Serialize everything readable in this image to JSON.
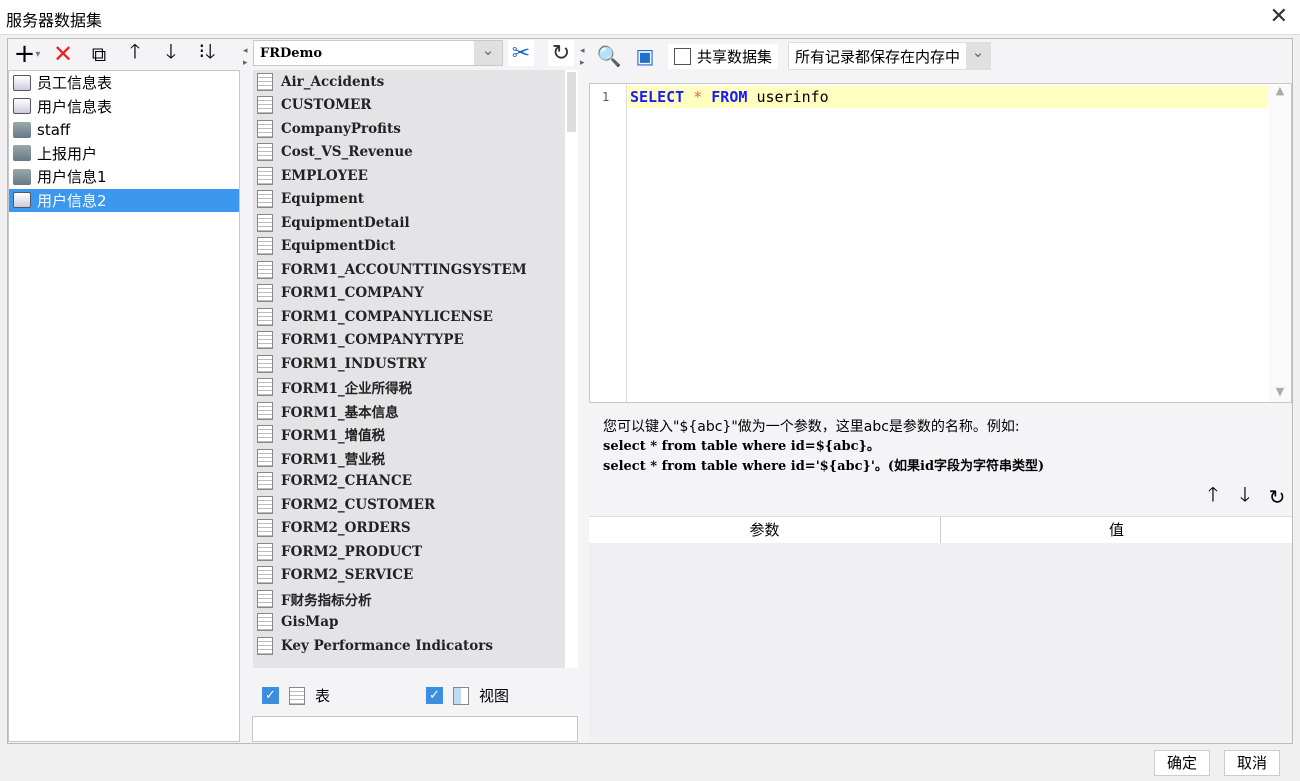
{
  "window": {
    "title": "服务器数据集",
    "close": "✕"
  },
  "left_toolbar": {
    "icons": [
      "add-icon",
      "delete-icon",
      "copy-icon",
      "move-up-icon",
      "move-down-icon",
      "sort-icon"
    ]
  },
  "datasets": [
    {
      "label": "员工信息表",
      "type": "sql"
    },
    {
      "label": "用户信息表",
      "type": "sql"
    },
    {
      "label": "staff",
      "type": "db"
    },
    {
      "label": "上报用户",
      "type": "db"
    },
    {
      "label": "用户信息1",
      "type": "db"
    },
    {
      "label": "用户信息2",
      "type": "sql",
      "selected": true
    }
  ],
  "connection": {
    "value": "FRDemo"
  },
  "tables": [
    "Air_Accidents",
    "CUSTOMER",
    "CompanyProfits",
    "Cost_VS_Revenue",
    "EMPLOYEE",
    "Equipment",
    "EquipmentDetail",
    "EquipmentDict",
    "FORM1_ACCOUNTTINGSYSTEM",
    "FORM1_COMPANY",
    "FORM1_COMPANYLICENSE",
    "FORM1_COMPANYTYPE",
    "FORM1_INDUSTRY",
    "FORM1_企业所得税",
    "FORM1_基本信息",
    "FORM1_增值税",
    "FORM1_营业税",
    "FORM2_CHANCE",
    "FORM2_CUSTOMER",
    "FORM2_ORDERS",
    "FORM2_PRODUCT",
    "FORM2_SERVICE",
    "F财务指标分析",
    "GisMap",
    "Key Performance Indicators"
  ],
  "filters": {
    "table_label": "表",
    "table_checked": true,
    "view_label": "视图",
    "view_checked": true
  },
  "right_toolbar": {
    "share_label": "共享数据集",
    "share_checked": false,
    "storage_value": "所有记录都保存在内存中"
  },
  "editor": {
    "line_number": "1",
    "kw1": "SELECT",
    "star": "*",
    "kw2": "FROM",
    "ident": "userinfo"
  },
  "hint": {
    "line1": "您可以键入\"${abc}\"做为一个参数，这里abc是参数的名称。例如:",
    "line2": "select * from table where id=${abc}。",
    "line3": "select * from table where id='${abc}'。(如果id字段为字符串类型)"
  },
  "params_table": {
    "headers": [
      "参数",
      "值"
    ]
  },
  "buttons": {
    "ok": "确定",
    "cancel": "取消"
  },
  "colors": {
    "selection": "#3c97ee",
    "keyword": "#1a1aff",
    "current_line": "#ffffc0"
  }
}
